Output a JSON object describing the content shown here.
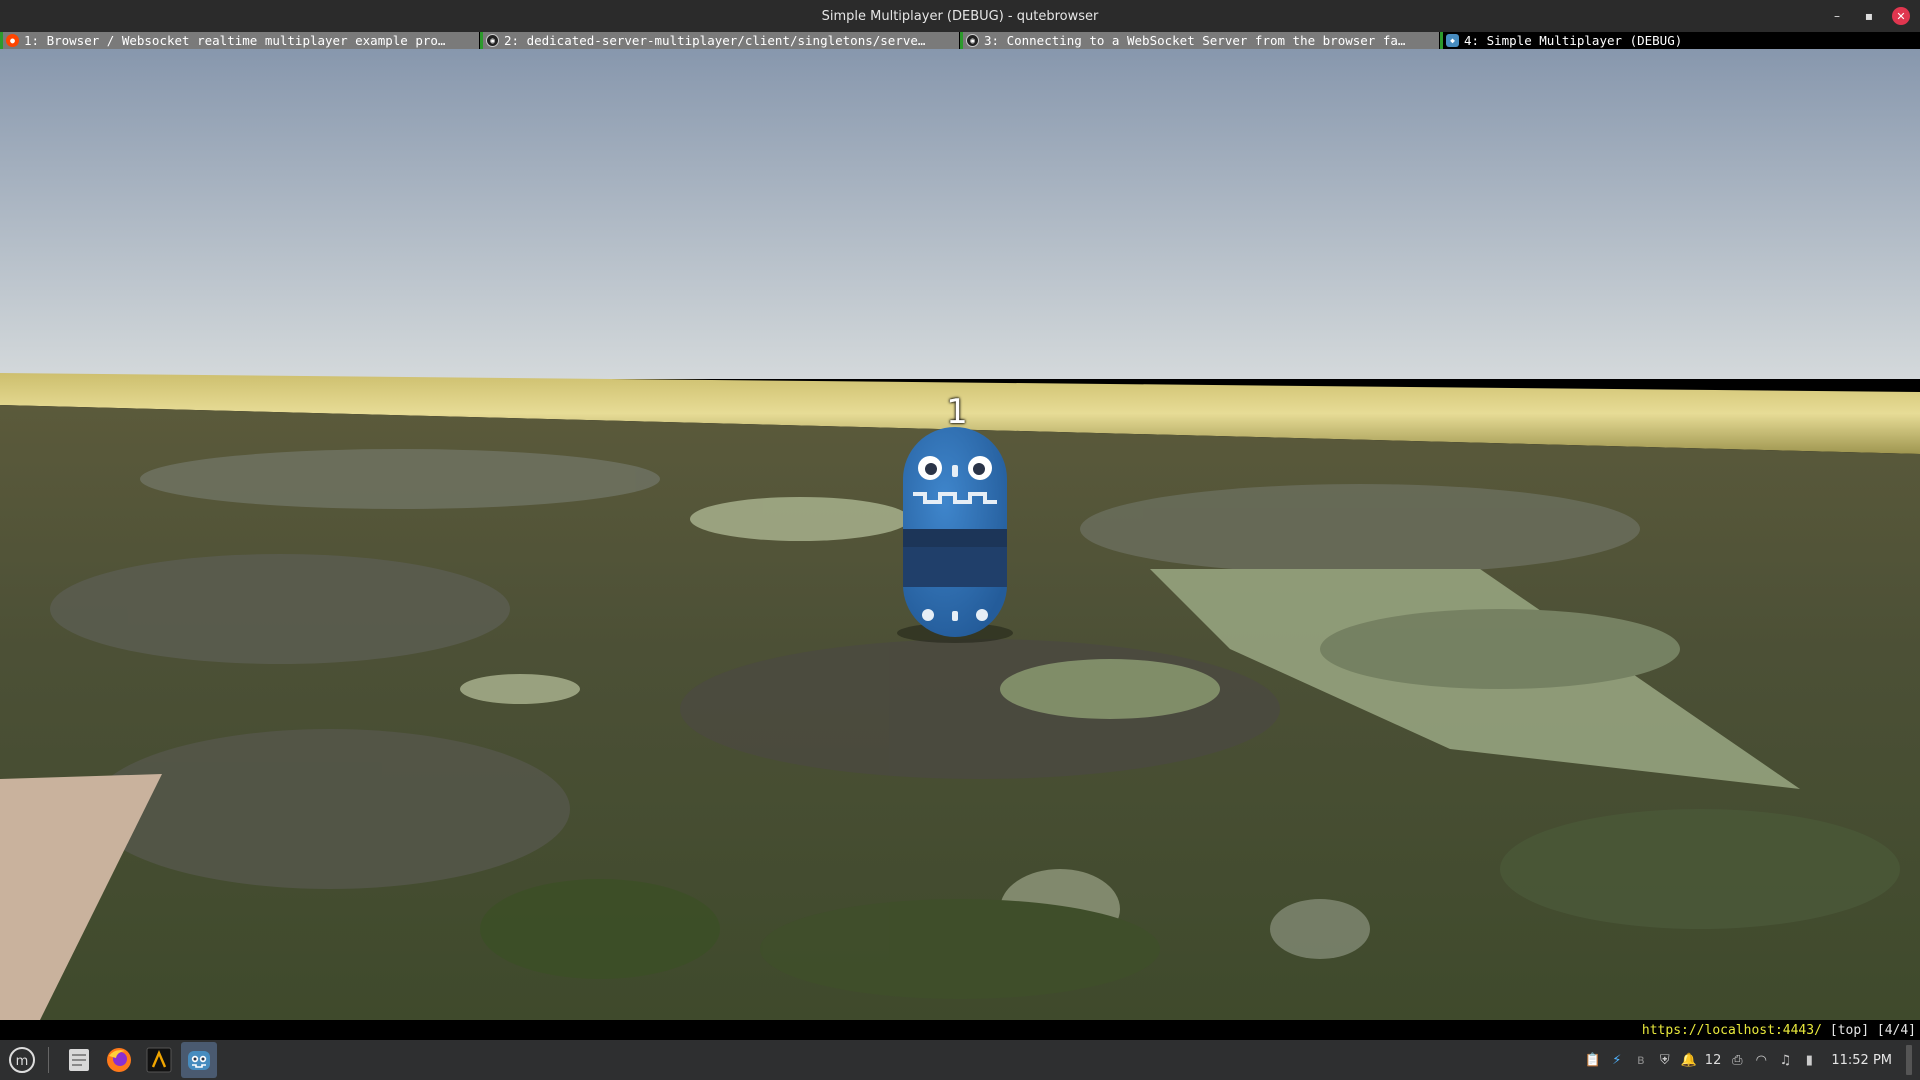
{
  "window": {
    "title": "Simple Multiplayer (DEBUG) - qutebrowser",
    "minimize_glyph": "–",
    "maximize_glyph": "▪",
    "close_glyph": "✕"
  },
  "tabs": [
    {
      "label": "1: Browser / Websocket realtime multiplayer example pro…",
      "icon": "reddit-icon",
      "active": false
    },
    {
      "label": "2: dedicated-server-multiplayer/client/singletons/serve…",
      "icon": "github-icon",
      "active": false
    },
    {
      "label": "3: Connecting to a WebSocket Server from the browser fa…",
      "icon": "github-icon",
      "active": false
    },
    {
      "label": "4: Simple Multiplayer (DEBUG)",
      "icon": "godot-icon",
      "active": true
    }
  ],
  "game": {
    "player_label": "1",
    "colors": {
      "sky_top": "#8a9ab0",
      "sky_bottom": "#cfd5d8",
      "horizon_band": "#d9cc7a",
      "ground": "#4a4d36",
      "character_body": "#2f6fb5",
      "character_dark": "#1c3558"
    }
  },
  "statusbar": {
    "url": "https://localhost:4443/",
    "position": "[top] [4/4]"
  },
  "taskbar": {
    "apps": [
      "menu-icon",
      "files-icon",
      "firefox-icon",
      "terminal-icon",
      "godot-icon"
    ],
    "tray": {
      "notification_count": "12",
      "clock": "11:52 PM"
    }
  }
}
